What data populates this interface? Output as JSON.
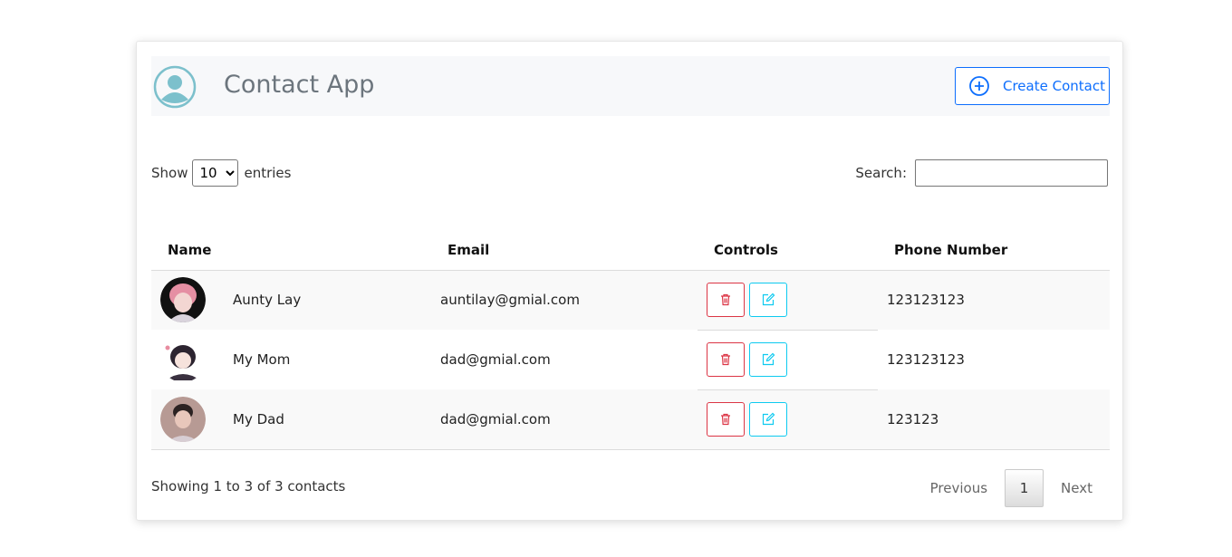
{
  "app": {
    "title": "Contact App",
    "create_label": "Create Contact"
  },
  "length": {
    "show_label": "Show",
    "selected": "10",
    "entries_label": "entries"
  },
  "search": {
    "label": "Search:",
    "value": ""
  },
  "table": {
    "columns": [
      "Name",
      "Email",
      "Controls",
      "Phone Number"
    ],
    "rows": [
      {
        "name": "Aunty Lay",
        "email": "auntilay@gmial.com",
        "phone": "123123123"
      },
      {
        "name": "My Mom",
        "email": "dad@gmial.com",
        "phone": "123123123"
      },
      {
        "name": "My Dad",
        "email": "dad@gmial.com",
        "phone": "123123"
      }
    ]
  },
  "footer": {
    "info": "Showing 1 to 3 of 3 contacts",
    "previous": "Previous",
    "page": "1",
    "next": "Next"
  },
  "colors": {
    "primary": "#0d6efd",
    "danger": "#dc3545",
    "info": "#0dcaf0",
    "logo": "#7cc0cc"
  }
}
